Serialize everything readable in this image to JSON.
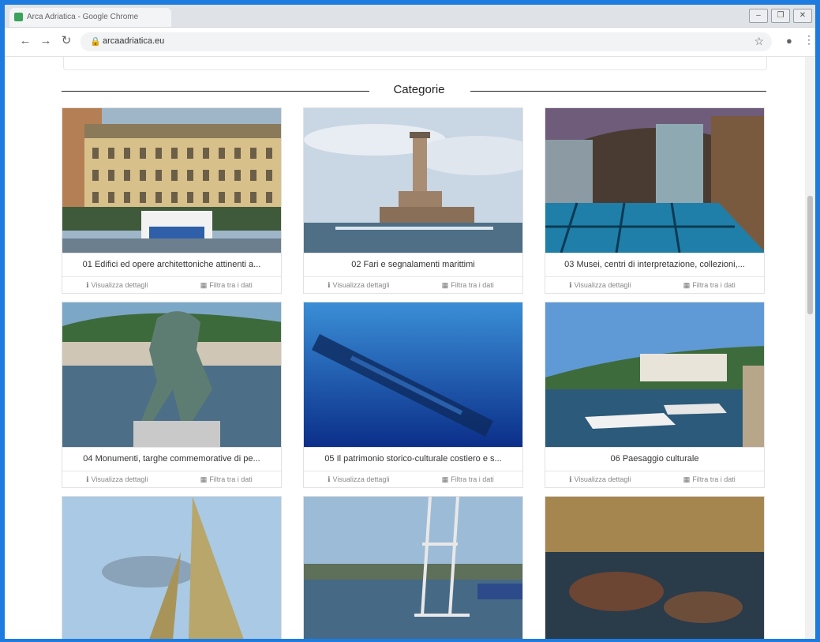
{
  "browser": {
    "tab_title": "Arca Adriatica - Google Chrome",
    "url": "arcaadriatica.eu",
    "window_buttons": [
      "–",
      "❐",
      "✕"
    ]
  },
  "page": {
    "heading": "Categorie",
    "categories": [
      {
        "title": "01 Edifici ed opere architettoniche attinenti a...",
        "details_label": "Visualizza dettagli",
        "filter_label": "Filtra tra i dati"
      },
      {
        "title": "02 Fari e segnalamenti marittimi",
        "details_label": "Visualizza dettagli",
        "filter_label": "Filtra tra i dati"
      },
      {
        "title": "03 Musei, centri di interpretazione, collezioni,...",
        "details_label": "Visualizza dettagli",
        "filter_label": "Filtra tra i dati"
      },
      {
        "title": "04 Monumenti, targhe commemorative di pe...",
        "details_label": "Visualizza dettagli",
        "filter_label": "Filtra tra i dati"
      },
      {
        "title": "05 Il patrimonio storico-culturale costiero e s...",
        "details_label": "Visualizza dettagli",
        "filter_label": "Filtra tra i dati"
      },
      {
        "title": "06 Paesaggio culturale",
        "details_label": "Visualizza dettagli",
        "filter_label": "Filtra tra i dati"
      }
    ]
  },
  "colors": {
    "frame": "#1e7be0",
    "text": "#333333"
  }
}
